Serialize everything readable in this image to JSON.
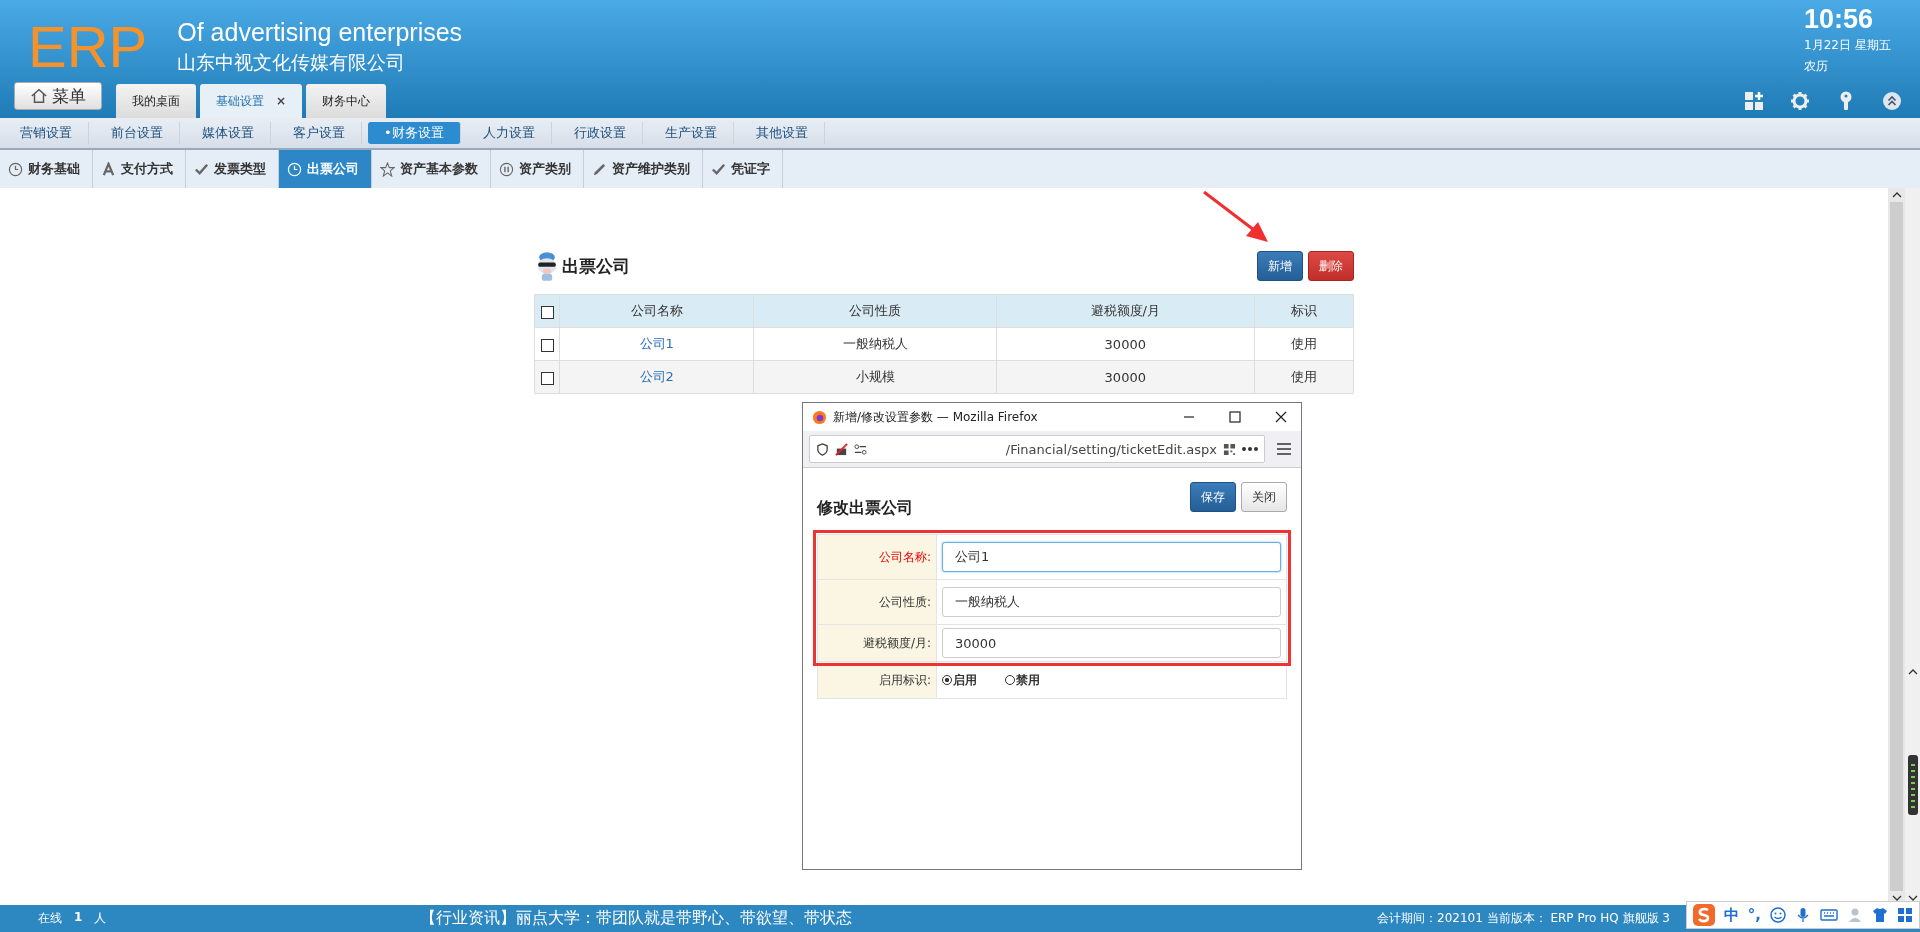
{
  "header": {
    "logo": "ERP",
    "slogan": "Of advertising enterprises",
    "company": "山东中视文化传媒有限公司",
    "time": "10:56",
    "date": "1月22日 星期五",
    "lunar": "农历"
  },
  "menu_button": "菜单",
  "tabs": [
    {
      "label": "我的桌面",
      "selected": false,
      "closable": false
    },
    {
      "label": "基础设置",
      "selected": true,
      "closable": true,
      "close": "×"
    },
    {
      "label": "财务中心",
      "selected": false,
      "closable": false
    }
  ],
  "nav": [
    {
      "label": "营销设置",
      "selected": false
    },
    {
      "label": "前台设置",
      "selected": false
    },
    {
      "label": "媒体设置",
      "selected": false
    },
    {
      "label": "客户设置",
      "selected": false
    },
    {
      "label": "•财务设置",
      "selected": true
    },
    {
      "label": "人力设置",
      "selected": false
    },
    {
      "label": "行政设置",
      "selected": false
    },
    {
      "label": "生产设置",
      "selected": false
    },
    {
      "label": "其他设置",
      "selected": false
    }
  ],
  "subtabs": [
    {
      "label": "财务基础",
      "kind": "clock",
      "selected": false
    },
    {
      "label": "支付方式",
      "kind": "letter",
      "selected": false
    },
    {
      "label": "发票类型",
      "kind": "check",
      "selected": false
    },
    {
      "label": "出票公司",
      "kind": "clock",
      "selected": true
    },
    {
      "label": "资产基本参数",
      "kind": "star",
      "selected": false
    },
    {
      "label": "资产类别",
      "kind": "pause",
      "selected": false
    },
    {
      "label": "资产维护类别",
      "kind": "pencil",
      "selected": false
    },
    {
      "label": "凭证字",
      "kind": "check",
      "selected": false
    }
  ],
  "page": {
    "title": "出票公司",
    "buttons": [
      {
        "label": "新增",
        "kind": "primary"
      },
      {
        "label": "删除",
        "kind": "danger"
      }
    ],
    "table": {
      "select_all": false,
      "columns": [
        "公司名称",
        "公司性质",
        "避税额度/月",
        "标识"
      ],
      "rows": [
        {
          "checked": false,
          "name": "公司1",
          "nature": "一般纳税人",
          "amount": "30000",
          "tag": "使用"
        },
        {
          "checked": false,
          "name": "公司2",
          "nature": "小规模",
          "amount": "30000",
          "tag": "使用"
        }
      ]
    }
  },
  "dialog": {
    "title": "新增/修改设置参数 — Mozilla Firefox",
    "url": "/Financial/setting/ticketEdit.aspx",
    "heading": "修改出票公司",
    "buttons": [
      {
        "label": "保存",
        "kind": "primary"
      },
      {
        "label": "关闭",
        "kind": "default"
      }
    ],
    "fields": [
      {
        "label": "公司名称:",
        "value": "公司1",
        "required": true,
        "focused": true,
        "highlighted": true
      },
      {
        "label": "公司性质:",
        "value": "一般纳税人",
        "required": false,
        "focused": false,
        "highlighted": true
      },
      {
        "label": "避税额度/月:",
        "value": "30000",
        "required": false,
        "focused": false,
        "highlighted": true
      }
    ],
    "status_field": {
      "label": "启用标识:",
      "options": [
        {
          "label": "启用",
          "selected": true
        },
        {
          "label": "禁用",
          "selected": false
        }
      ]
    }
  },
  "status_bar": {
    "online_label": "在线",
    "online_count": "1",
    "online_unit": "人",
    "news": "【行业资讯】丽点大学：带团队就是带野心、带欲望、带状态",
    "period": "会计期间：202101 当前版本： ERP Pro HQ 旗舰版 3"
  },
  "ime": {
    "mode": "中",
    "punct": "°,"
  }
}
